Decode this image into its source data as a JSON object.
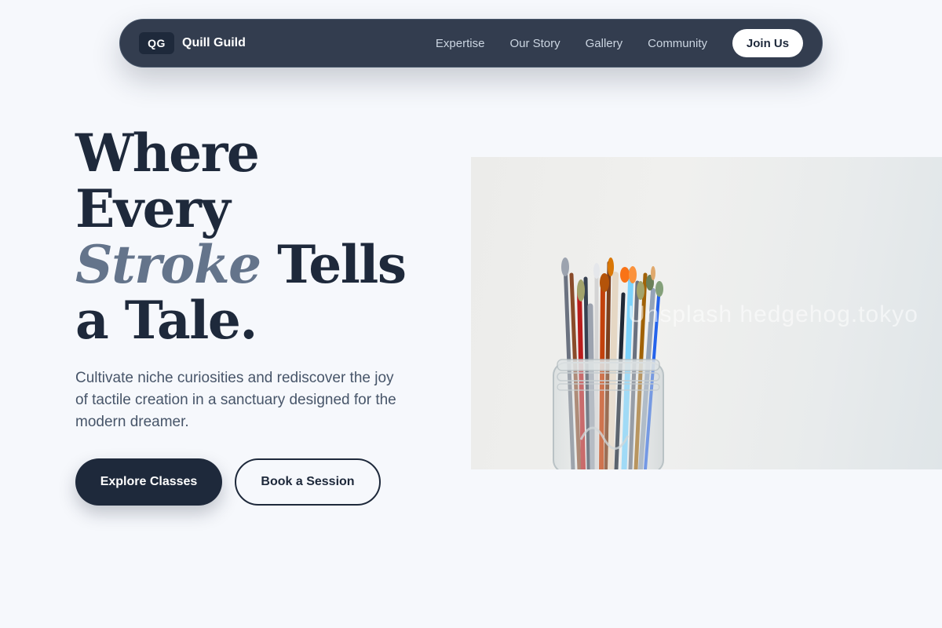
{
  "nav": {
    "badge": "QG",
    "brand": "Quill Guild",
    "links": [
      "Expertise",
      "Our Story",
      "Gallery",
      "Community"
    ],
    "cta": "Join Us"
  },
  "hero": {
    "title_line1": "Where",
    "title_line2": "Every",
    "title_accent": "Stroke",
    "title_line3_rest": "Tells",
    "title_line4": "a Tale.",
    "subtitle": "Cultivate niche curiosities and rediscover the joy of tactile creation in a sanctuary designed for the modern dreamer.",
    "primary_cta": "Explore Classes",
    "secondary_cta": "Book a Session"
  },
  "image": {
    "subject": "paint-brushes-in-glass-jar",
    "watermark": "Unsplash hedgehog.tokyo"
  },
  "colors": {
    "background": "#f6f8fc",
    "nav_bg": "#333d4f",
    "primary": "#1e293b",
    "accent": "#64748b",
    "muted_text": "#475569"
  }
}
